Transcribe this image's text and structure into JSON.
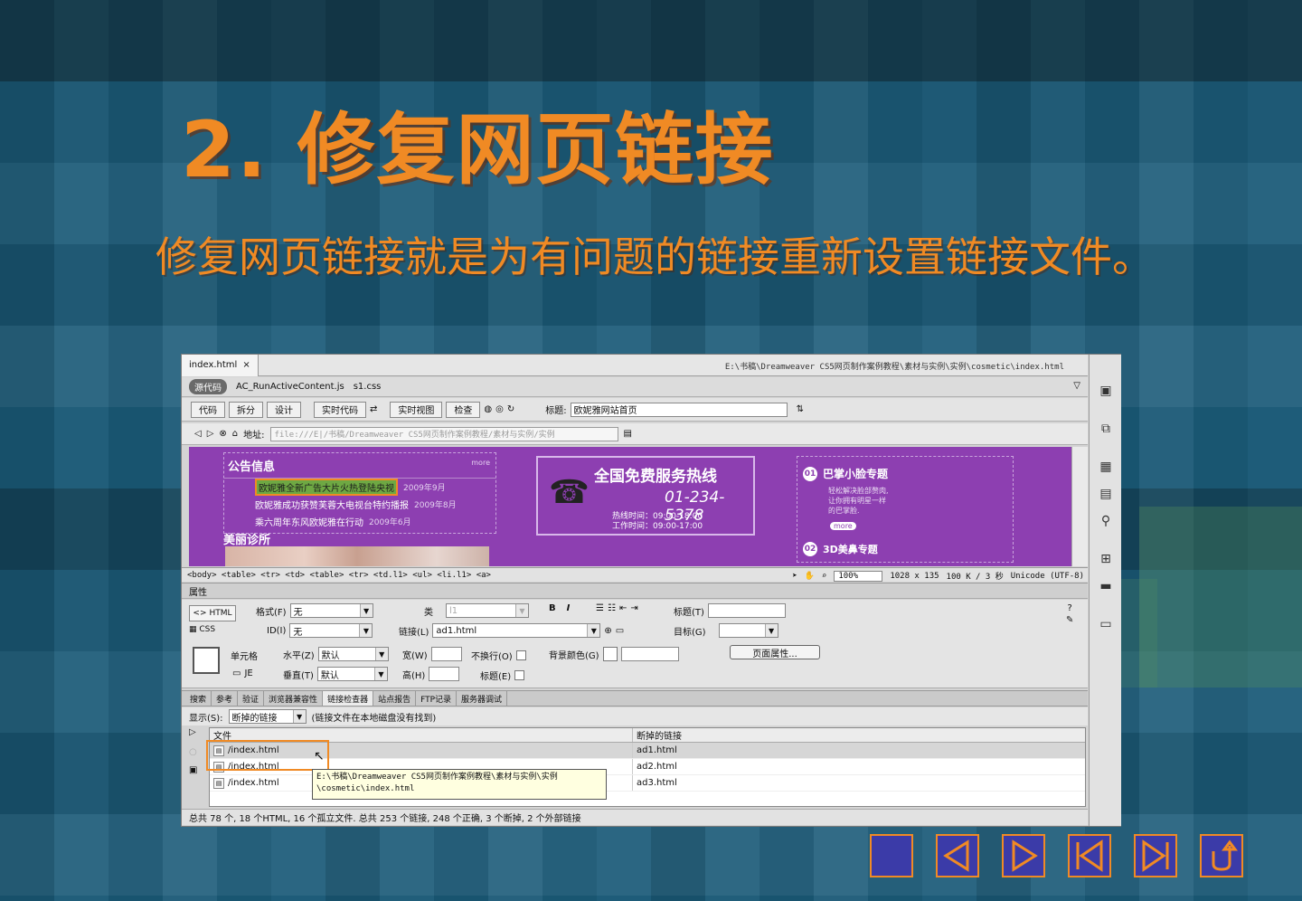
{
  "slide": {
    "title": "2. 修复网页链接",
    "body": "修复网页链接就是为有问题的链接重新设置链接文件。"
  },
  "doc_tabs": {
    "active": "index.html",
    "close": "×",
    "path": "E:\\书稿\\Dreamweaver CS5网页制作案例教程\\素材与实例\\实例\\cosmetic\\index.html"
  },
  "related_files": {
    "source": "源代码",
    "files": [
      "AC_RunActiveContent.js",
      "s1.css"
    ]
  },
  "toolbar": {
    "code": "代码",
    "split": "拆分",
    "design": "设计",
    "live_code": "实时代码",
    "live_view": "实时视图",
    "inspect": "检查",
    "title_label": "标题:",
    "title_value": "欧妮雅网站首页"
  },
  "address": {
    "label": "地址:",
    "value": "file:///E|/书稿/Dreamweaver CS5网页制作案例教程/素材与实例/实例"
  },
  "design_view": {
    "notice_title": "公告信息",
    "notice_more": "more",
    "news": [
      {
        "text": "欧妮雅全新广告大片火热登陆央视",
        "date": "2009年9月"
      },
      {
        "text": "欧妮雅成功获赞芙蓉大电视台特约播报",
        "date": "2009年8月"
      },
      {
        "text": "乘六周年东风欧妮雅在行动",
        "date": "2009年6月"
      }
    ],
    "beauty_title": "美丽诊所",
    "hotline_title": "全国免费服务热线",
    "hotline_number": "01-234-5378",
    "hotline_hours": [
      "热线时间：09:00-18:00",
      "工作时间：09:00-17:00"
    ],
    "special1_num": "01",
    "special1_title": "巴掌小脸专题",
    "special1_desc": [
      "轻松解决脸部赘肉,",
      "让你拥有明星一样",
      "的巴掌脸."
    ],
    "special1_more": "more",
    "special2_num": "02",
    "special2_title": "3D美鼻专题"
  },
  "status": {
    "tags": "<body> <table> <tr> <td> <table> <tr> <td.l1> <ul> <li.l1> <a>",
    "zoom": "100%",
    "size": "1028 x 135",
    "weight": "100 K / 3 秒",
    "encoding": "Unicode (UTF-8)"
  },
  "properties": {
    "header": "属性",
    "html": "HTML",
    "css": "CSS",
    "format_label": "格式(F)",
    "format_value": "无",
    "class_label": "类",
    "class_value": "l1",
    "id_label": "ID(I)",
    "id_value": "无",
    "link_label": "链接(L)",
    "link_value": "ad1.html",
    "title_label": "标题(T)",
    "target_label": "目标(G)",
    "bold": "B",
    "italic": "I",
    "cell_label": "单元格",
    "split_label": "JE",
    "horz_label": "水平(Z)",
    "horz_value": "默认",
    "vert_label": "垂直(T)",
    "vert_value": "默认",
    "width_label": "宽(W)",
    "height_label": "高(H)",
    "nowrap_label": "不换行(O)",
    "header_label": "标题(E)",
    "bg_label": "背景颜色(G)",
    "page_props": "页面属性..."
  },
  "panel_tabs": [
    "搜索",
    "参考",
    "验证",
    "浏览器兼容性",
    "链接检查器",
    "站点报告",
    "FTP记录",
    "服务器调试"
  ],
  "active_panel": "链接检查器",
  "link_checker": {
    "show_label": "显示(S):",
    "show_value": "断掉的链接",
    "hint": "(链接文件在本地磁盘没有找到)",
    "col_file": "文件",
    "col_broken": "断掉的链接",
    "rows": [
      {
        "file": "/index.html",
        "link": "ad1.html"
      },
      {
        "file": "/index.html",
        "link": "ad2.html"
      },
      {
        "file": "/index.html",
        "link": "ad3.html"
      }
    ],
    "tooltip": [
      "E:\\书稿\\Dreamweaver CS5网页制作案例教程\\素材与实例\\实例",
      "\\cosmetic\\index.html"
    ],
    "summary": "总共 78 个, 18 个HTML, 16 个孤立文件. 总共 253 个链接, 248 个正确, 3 个断掉, 2 个外部链接"
  },
  "nav": [
    "stop-icon",
    "prev-icon",
    "next-icon",
    "first-icon",
    "last-icon",
    "return-icon"
  ],
  "colors": {
    "accent": "#f08a24",
    "background": "#1b5b78",
    "design_purple": "#8d3fb1",
    "nav_blue": "#3b3ba8"
  }
}
